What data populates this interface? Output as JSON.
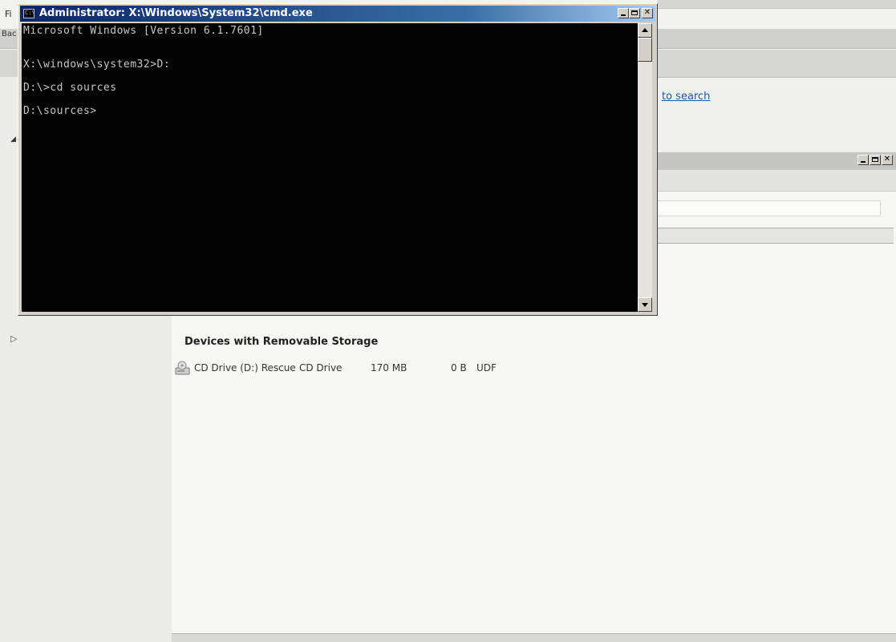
{
  "background_window": {
    "menu_file": "Fi",
    "back_button": "Bac",
    "link_search": "to search"
  },
  "cmd": {
    "title": "Administrator: X:\\Windows\\System32\\cmd.exe",
    "icon_text": "C:\\",
    "lines": [
      "Microsoft Windows [Version 6.1.7601]",
      "",
      "X:\\windows\\system32>D:",
      "",
      "D:\\>cd sources",
      "",
      "D:\\sources>"
    ]
  },
  "disk_management": {
    "section_title": "Devices with Removable Storage",
    "devices": [
      {
        "name": "CD Drive (D:) Rescue",
        "type": "CD Drive",
        "total_size": "170 MB",
        "free_space": "0 B",
        "file_system": "UDF",
        "icon": "cd-drive-icon"
      }
    ]
  },
  "colors": {
    "title_bar_start": "#0a246a",
    "title_bar_end": "#a6caf0",
    "console_bg": "#030303",
    "console_text": "#c6c6c6",
    "link": "#1d5aa8"
  }
}
